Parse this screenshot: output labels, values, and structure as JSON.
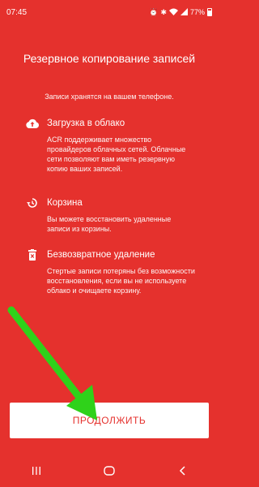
{
  "status_bar": {
    "time": "07:45",
    "battery": "77%",
    "icons": [
      "alarm-icon",
      "bluetooth-icon",
      "wifi-icon",
      "signal-icon",
      "battery-icon"
    ]
  },
  "title": "Резервное копирование записей",
  "subtitle": "Записи хранятся на вашем телефоне.",
  "sections": [
    {
      "icon": "cloud-upload-icon",
      "title": "Загрузка в облако",
      "body": "ACR поддерживает множество провайдеров облачных сетей. Облачные сети позволяют вам иметь резервную копию ваших записей."
    },
    {
      "icon": "restore-icon",
      "title": "Корзина",
      "body": "Вы можете восстановить удаленные записи из корзины."
    },
    {
      "icon": "delete-forever-icon",
      "title": "Безвозвратное удаление",
      "body": "Стертые записи потеряны без возможности восстановления, если вы не используете облако и очищаете корзину."
    }
  ],
  "continue_button": "ПРОДОЛЖИТЬ",
  "nav_bar": {
    "icons": [
      "recents-icon",
      "home-icon",
      "back-icon"
    ]
  },
  "colors": {
    "background": "#e5312d",
    "button_bg": "#ffffff",
    "button_text": "#e5312d",
    "arrow": "#2fd21a"
  }
}
